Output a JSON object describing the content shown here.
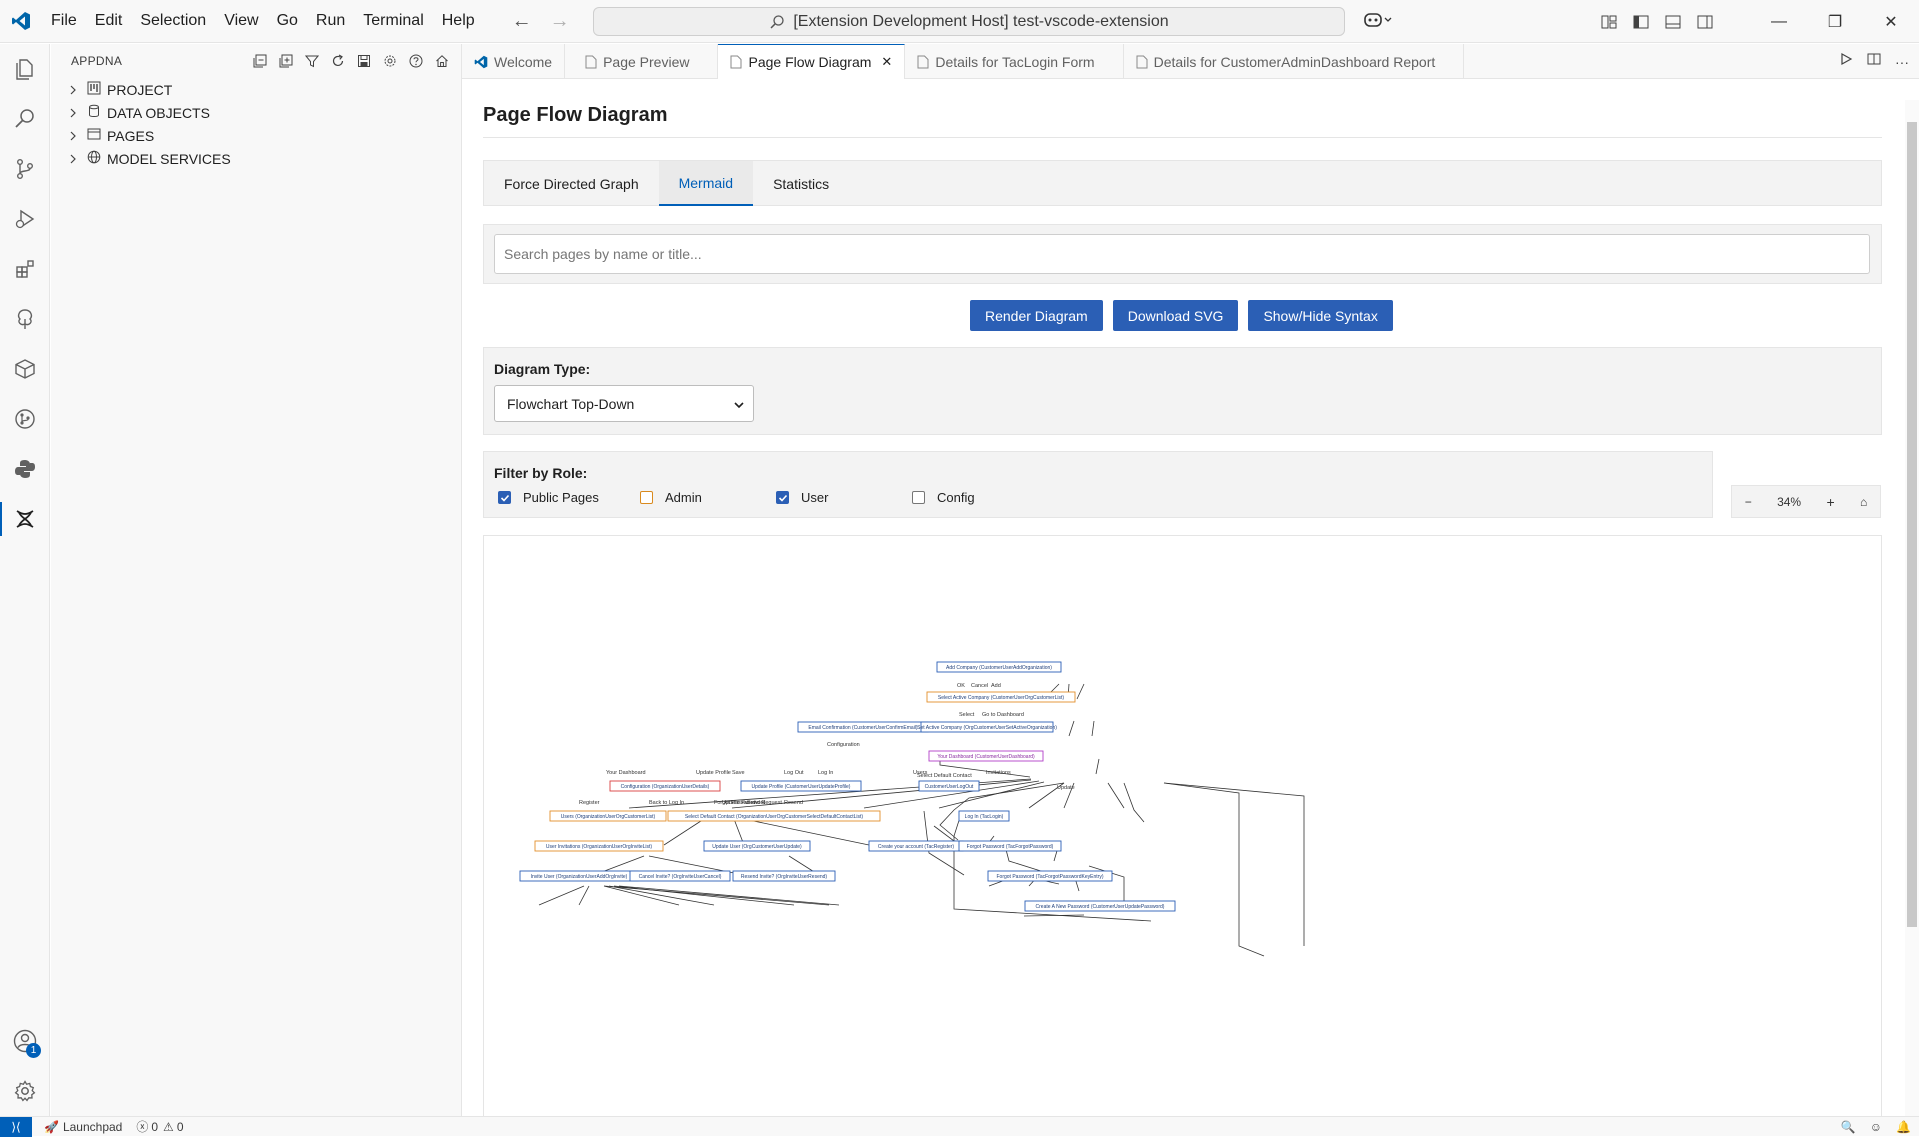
{
  "titlebar": {
    "menu": [
      "File",
      "Edit",
      "Selection",
      "View",
      "Go",
      "Run",
      "Terminal",
      "Help"
    ],
    "command_center": "[Extension Development Host] test-vscode-extension"
  },
  "sidebar": {
    "title": "APPDNA",
    "items": [
      {
        "label": "PROJECT",
        "icon": "project-icon"
      },
      {
        "label": "DATA OBJECTS",
        "icon": "database-icon"
      },
      {
        "label": "PAGES",
        "icon": "window-icon"
      },
      {
        "label": "MODEL SERVICES",
        "icon": "globe-icon"
      }
    ]
  },
  "activitybar": {
    "accounts_badge": "1"
  },
  "tabs": [
    {
      "label": "Welcome",
      "icon": "vscode-icon"
    },
    {
      "label": "Page Preview",
      "icon": "file-icon"
    },
    {
      "label": "Page Flow Diagram",
      "icon": "file-icon",
      "active": true
    },
    {
      "label": "Details for TacLogin Form",
      "icon": "file-icon"
    },
    {
      "label": "Details for CustomerAdminDashboard Report",
      "icon": "file-icon"
    }
  ],
  "main": {
    "title": "Page Flow Diagram",
    "view_tabs": [
      "Force Directed Graph",
      "Mermaid",
      "Statistics"
    ],
    "active_view_tab": "Mermaid",
    "search_placeholder": "Search pages by name or title...",
    "buttons": {
      "render": "Render Diagram",
      "download": "Download SVG",
      "syntax": "Show/Hide Syntax"
    },
    "diagram_type_label": "Diagram Type:",
    "diagram_type_value": "Flowchart Top-Down",
    "filter_label": "Filter by Role:",
    "filters": [
      {
        "label": "Public Pages",
        "checked": true
      },
      {
        "label": "Admin",
        "checked": false
      },
      {
        "label": "User",
        "checked": true
      },
      {
        "label": "Config",
        "checked": false
      }
    ],
    "zoom": {
      "minus": "−",
      "level": "34%",
      "plus": "+",
      "home": "⌂"
    }
  },
  "diagram": {
    "nodes": [
      {
        "label": "Add Company (CustomerUserAddOrganization)",
        "color": "#2b5fb5"
      },
      {
        "label": "Select Active Company (CustomerUserOrgCustomerList)",
        "color": "#e3902b"
      },
      {
        "label": "Email Confirmation (CustomerUserConfirmEmail)",
        "color": "#2b5fb5"
      },
      {
        "label": "Set Active Company (OrgCustomerUserSetActiveOrganization)",
        "color": "#2b5fb5"
      },
      {
        "label": "Your Dashboard (CustomerUserDashboard)",
        "color": "#b13fc7"
      },
      {
        "label": "Configuration (OrganizationUserDetails)",
        "color": "#d94040"
      },
      {
        "label": "Update Profile (CustomerUserUpdateProfile)",
        "color": "#2b5fb5"
      },
      {
        "label": "CustomerUserLogOut",
        "color": "#2b5fb5"
      },
      {
        "label": "Users (OrganizationUserOrgCustomerList)",
        "color": "#e3902b"
      },
      {
        "label": "Select Default Contact (OrganizationUserOrgCustomerSelectDefaultContactList)",
        "color": "#e3902b"
      },
      {
        "label": "Log In (TacLogin)",
        "color": "#2b5fb5"
      },
      {
        "label": "User Invitations (OrganizationUserOrgInviteList)",
        "color": "#e3902b"
      },
      {
        "label": "Update User (OrgCustomerUserUpdate)",
        "color": "#2b5fb5"
      },
      {
        "label": "Create your account (TacRegister)",
        "color": "#2b5fb5"
      },
      {
        "label": "Forgot Password (TacForgotPassword)",
        "color": "#2b5fb5"
      },
      {
        "label": "Invite User (OrganizationUserAddOrgInvite)",
        "color": "#2b5fb5"
      },
      {
        "label": "Cancel Invite? (OrgInviteUserCancel)",
        "color": "#2b5fb5"
      },
      {
        "label": "Resend Invite? (OrgInviteUserResend)",
        "color": "#2b5fb5"
      },
      {
        "label": "Forgot Password (TacForgotPasswordKeyEntry)",
        "color": "#2b5fb5"
      },
      {
        "label": "Create A New Password (CustomerUserUpdatePassword)",
        "color": "#2b5fb5"
      }
    ],
    "edge_labels": [
      "OK",
      "Cancel",
      "Add",
      "Select",
      "Go to Dashboard",
      "Configuration",
      "Your Dashboard",
      "Update Profile",
      "Save",
      "Log Out",
      "Log In",
      "Users",
      "Select Default Contact",
      "Invitations",
      "Update",
      "Register",
      "Back to Log In",
      "Forgot Password",
      "Update Password",
      "Send Request",
      "Resend"
    ]
  },
  "statusbar": {
    "launchpad": "Launchpad",
    "errors": "0",
    "warnings": "0"
  },
  "colors": {
    "accent": "#005fb8",
    "button": "#2b5fb5",
    "user_node": "#2b5fb5",
    "admin_node": "#e3902b",
    "config_node": "#d94040",
    "dashboard_node": "#b13fc7"
  }
}
